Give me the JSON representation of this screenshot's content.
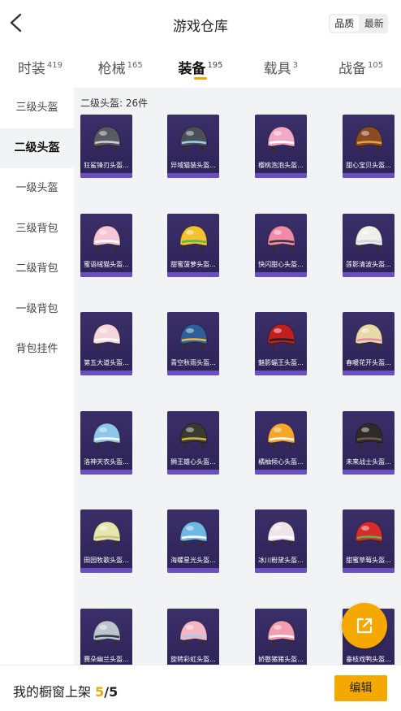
{
  "header": {
    "title": "游戏仓库",
    "sort_options": [
      "品质",
      "最新"
    ],
    "sort_active": "品质"
  },
  "tabs": [
    {
      "label": "时装",
      "count": "419",
      "active": false
    },
    {
      "label": "枪械",
      "count": "165",
      "active": false
    },
    {
      "label": "装备",
      "count": "195",
      "active": true
    },
    {
      "label": "载具",
      "count": "3",
      "active": false
    },
    {
      "label": "战备",
      "count": "105",
      "active": false
    }
  ],
  "sidebar": {
    "items": [
      {
        "label": "三级头盔",
        "active": false
      },
      {
        "label": "二级头盔",
        "active": true
      },
      {
        "label": "一级头盔",
        "active": false
      },
      {
        "label": "三级背包",
        "active": false
      },
      {
        "label": "二级背包",
        "active": false
      },
      {
        "label": "一级背包",
        "active": false
      },
      {
        "label": "背包挂件",
        "active": false
      }
    ]
  },
  "content": {
    "section_label": "二级头盔: 26件",
    "items": [
      {
        "name": "狂鲨锋刃头盔...",
        "color": "#5a5a63",
        "accent": "#c9ced8"
      },
      {
        "name": "异域猫装头盔...",
        "color": "#4a4f59",
        "accent": "#8fd6e3"
      },
      {
        "name": "樱桃泡泡头盔...",
        "color": "#f2a9c6",
        "accent": "#ffffff"
      },
      {
        "name": "甜心宝贝头盔...",
        "color": "#8a4a22",
        "accent": "#e6a23c"
      },
      {
        "name": "蜜语绒猫头盔...",
        "color": "#f5c6d6",
        "accent": "#ffffff"
      },
      {
        "name": "甜蜜菠萝头盔...",
        "color": "#f2c230",
        "accent": "#5bb64a"
      },
      {
        "name": "快闪甜心头盔...",
        "color": "#f08aa8",
        "accent": "#333333"
      },
      {
        "name": "莲影清波头盔...",
        "color": "#eeeeea",
        "accent": "#cfd6de"
      },
      {
        "name": "第五大道头盔...",
        "color": "#f6d6dc",
        "accent": "#ffffff"
      },
      {
        "name": "青空秋雨头盔...",
        "color": "#2d5f9a",
        "accent": "#f2b640"
      },
      {
        "name": "魅影蝠王头盔...",
        "color": "#c41f1f",
        "accent": "#222222"
      },
      {
        "name": "春暖花开头盔...",
        "color": "#e7d9a8",
        "accent": "#e58ba6"
      },
      {
        "name": "洛神天衣头盔...",
        "color": "#8dc7ea",
        "accent": "#ffffff"
      },
      {
        "name": "狮王雄心头盔...",
        "color": "#3a3a2e",
        "accent": "#d6b24a"
      },
      {
        "name": "橘柚倾心头盔...",
        "color": "#f6a72a",
        "accent": "#ffffff"
      },
      {
        "name": "未来战士头盔...",
        "color": "#2e2a28",
        "accent": "#6e5a50"
      },
      {
        "name": "田园牧歌头盔...",
        "color": "#e8e6b0",
        "accent": "#c9c37a"
      },
      {
        "name": "海螺星光头盔...",
        "color": "#6fb7e6",
        "accent": "#ffffff"
      },
      {
        "name": "冰川粉黛头盔...",
        "color": "#f1e3ea",
        "accent": "#ffffff"
      },
      {
        "name": "甜蜜草莓头盔...",
        "color": "#d92b2b",
        "accent": "#5bb64a"
      },
      {
        "name": "赛朵幽兰头盔...",
        "color": "#bcc4ce",
        "accent": "#2e3a44"
      },
      {
        "name": "旋转彩虹头盔...",
        "color": "#f6b6c3",
        "accent": "#9fd0f0"
      },
      {
        "name": "娇憨猪猪头盔...",
        "color": "#f39db0",
        "accent": "#ffffff"
      },
      {
        "name": "垂枝戏鸭头盔...",
        "color": "#f0b060",
        "accent": "#ffffff"
      }
    ]
  },
  "bottom": {
    "label": "我的橱窗上架",
    "current": "5",
    "total": "/5",
    "edit_label": "编辑"
  },
  "colors": {
    "accent": "#f5a800",
    "card_bg": "#3b2f69",
    "panel_bg": "#f2f3f5"
  }
}
